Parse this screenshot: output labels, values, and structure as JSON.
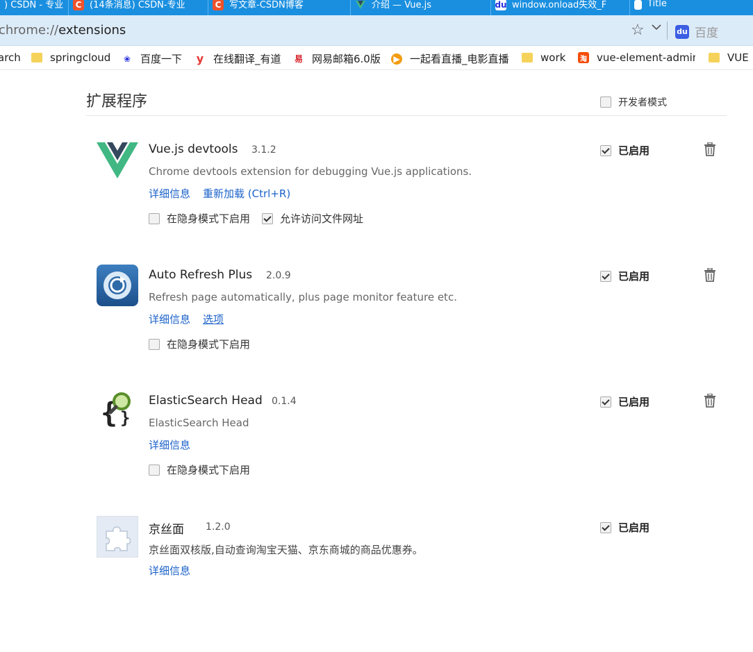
{
  "tabs": [
    {
      "title": ") CSDN - 专业",
      "icon": "none"
    },
    {
      "title": "(14条消息) CSDN-专业",
      "icon": "csdn-icon"
    },
    {
      "title": "写文章-CSDN博客",
      "icon": "csdn-icon"
    },
    {
      "title": "介绍 — Vue.js",
      "icon": "vue-icon"
    },
    {
      "title": "window.onload失效_F",
      "icon": "baidu-icon"
    },
    {
      "title": "Title",
      "icon": "document-icon"
    }
  ],
  "omnibox": {
    "scheme": "chrome://",
    "path": "extensions",
    "search_engine": "百度"
  },
  "bookmarks": [
    {
      "label": "arch",
      "icon": "none"
    },
    {
      "label": "springcloud",
      "icon": "folder-icon"
    },
    {
      "label": "百度一下",
      "icon": "baidu-icon"
    },
    {
      "label": "在线翻译_有道",
      "icon": "youdao-icon"
    },
    {
      "label": "网易邮箱6.0版",
      "icon": "netease-mail-icon"
    },
    {
      "label": "一起看直播_电影直播",
      "icon": "live-icon"
    },
    {
      "label": "work",
      "icon": "folder-icon"
    },
    {
      "label": "vue-element-admin",
      "icon": "taobao-icon"
    },
    {
      "label": "VUE",
      "icon": "folder-icon"
    }
  ],
  "page": {
    "title": "扩展程序",
    "developer_mode_label": "开发者模式",
    "developer_mode_checked": false
  },
  "extensions": [
    {
      "name": "Vue.js devtools",
      "version": "3.1.2",
      "description": "Chrome devtools extension for debugging Vue.js applications.",
      "links": [
        "详细信息",
        "重新加载 (Ctrl+R)"
      ],
      "options": [
        {
          "label": "在隐身模式下启用",
          "checked": false
        },
        {
          "label": "允许访问文件网址",
          "checked": true
        }
      ],
      "enabled_label": "已启用",
      "enabled": true,
      "icon": "vue-logo-icon"
    },
    {
      "name": "Auto Refresh Plus",
      "version": "2.0.9",
      "description": "Refresh page automatically, plus page monitor feature etc.",
      "links": [
        "详细信息",
        "选项"
      ],
      "options": [
        {
          "label": "在隐身模式下启用",
          "checked": false
        }
      ],
      "enabled_label": "已启用",
      "enabled": true,
      "icon": "refresh-icon"
    },
    {
      "name": "ElasticSearch Head",
      "version": "0.1.4",
      "description": "ElasticSearch Head",
      "links": [
        "详细信息"
      ],
      "options": [
        {
          "label": "在隐身模式下启用",
          "checked": false
        }
      ],
      "enabled_label": "已启用",
      "enabled": true,
      "icon": "elasticsearch-head-icon"
    },
    {
      "name": "京丝面",
      "version": "1.2.0",
      "description": "京丝面双核版,自动查询淘宝天猫、京东商城的商品优惠券。",
      "links": [
        "详细信息"
      ],
      "options": [],
      "enabled_label": "已启用",
      "enabled": true,
      "icon": "puzzle-piece-icon"
    }
  ]
}
